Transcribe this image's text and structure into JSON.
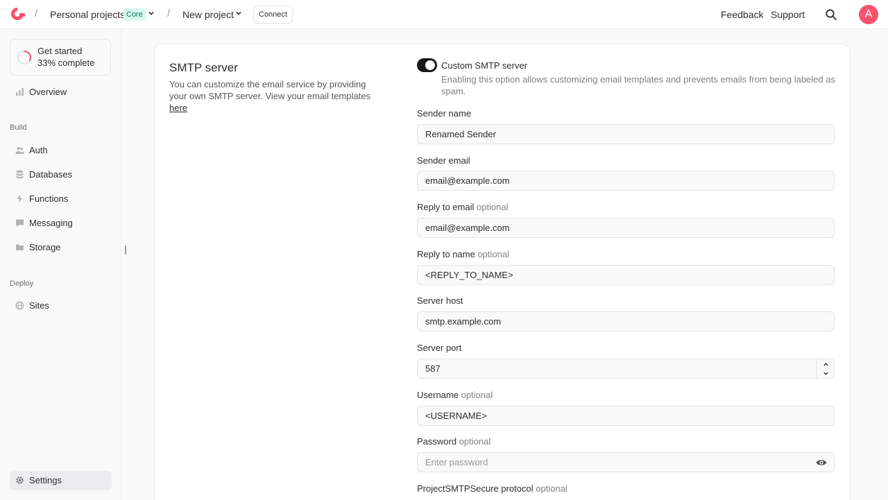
{
  "header": {
    "project_group": "Personal projects",
    "plan_badge": "Core",
    "project": "New project",
    "connect_label": "Connect",
    "feedback_label": "Feedback",
    "support_label": "Support",
    "avatar_initial": "A"
  },
  "sidebar": {
    "get_started_title": "Get started",
    "get_started_progress": "33% complete",
    "progress_fraction": 0.33,
    "overview_label": "Overview",
    "build_section": "Build",
    "build_items": [
      "Auth",
      "Databases",
      "Functions",
      "Messaging",
      "Storage"
    ],
    "deploy_section": "Deploy",
    "deploy_items": [
      "Sites"
    ],
    "settings_label": "Settings"
  },
  "smtp": {
    "title": "SMTP server",
    "description": "You can customize the email service by providing your own SMTP server. View your email templates",
    "link_text": "here",
    "toggle_label": "Custom SMTP server",
    "toggle_on": true,
    "toggle_description": "Enabling this option allows customizing email templates and prevents emails from being labeled as spam.",
    "optional_text": "optional",
    "fields": {
      "sender_name": {
        "label": "Sender name",
        "value": "Renamed Sender"
      },
      "sender_email": {
        "label": "Sender email",
        "value": "email@example.com"
      },
      "reply_to_email": {
        "label": "Reply to email",
        "value": "email@example.com"
      },
      "reply_to_name": {
        "label": "Reply to name",
        "value": "<REPLY_TO_NAME>"
      },
      "server_host": {
        "label": "Server host",
        "value": "smtp.example.com"
      },
      "server_port": {
        "label": "Server port",
        "value": "587"
      },
      "username": {
        "label": "Username",
        "value": "<USERNAME>"
      },
      "password": {
        "label": "Password",
        "placeholder": "Enter password"
      },
      "secure_protocol": {
        "label": "ProjectSMTPSecure protocol"
      }
    }
  },
  "colors": {
    "accent": "#f5526f",
    "badge_bg": "#d9f6ee",
    "badge_text": "#0a7a5c",
    "toggle_on": "#19191c"
  }
}
